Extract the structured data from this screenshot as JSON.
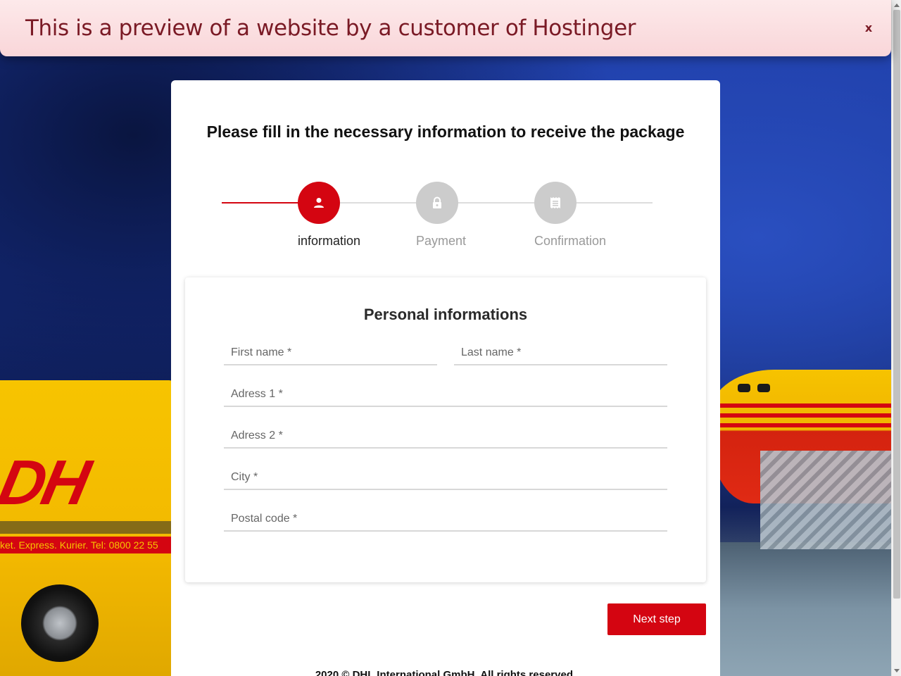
{
  "banner": {
    "text": "This is a preview of a website by a customer of Hostinger",
    "close_label": "x"
  },
  "background": {
    "van_logo": "DH",
    "van_text": "ket. Express. Kurier.   Tel: 0800 22 55"
  },
  "page": {
    "title": "Please fill in the necessary information to receive the package"
  },
  "stepper": {
    "steps": [
      {
        "label": "information",
        "icon": "user-icon",
        "active": true
      },
      {
        "label": "Payment",
        "icon": "lock-icon",
        "active": false
      },
      {
        "label": "Confirmation",
        "icon": "receipt-icon",
        "active": false
      }
    ]
  },
  "form": {
    "title": "Personal informations",
    "fields": {
      "first_name": {
        "placeholder": "First name *",
        "value": ""
      },
      "last_name": {
        "placeholder": "Last name *",
        "value": ""
      },
      "address1": {
        "placeholder": "Adress 1 *",
        "value": ""
      },
      "address2": {
        "placeholder": "Adress 2 *",
        "value": ""
      },
      "city": {
        "placeholder": "City *",
        "value": ""
      },
      "postal_code": {
        "placeholder": "Postal code *",
        "value": ""
      }
    }
  },
  "actions": {
    "next_label": "Next step"
  },
  "footer": {
    "text": "2020 © DHL International GmbH. All rights reserved."
  },
  "colors": {
    "brand_red": "#d40511",
    "brand_yellow": "#f7c400",
    "banner_bg": "#f9d6d9",
    "banner_text": "#7a1a25"
  }
}
